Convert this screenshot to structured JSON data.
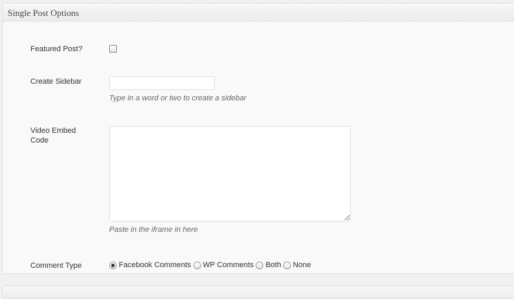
{
  "metabox": {
    "title": "Single Post Options"
  },
  "featured": {
    "label": "Featured Post?",
    "checked": false
  },
  "sidebar": {
    "label": "Create Sidebar",
    "value": "",
    "hint": "Type in a word or two to create a sidebar"
  },
  "video": {
    "label_line1": "Video Embed",
    "label_line2": "Code",
    "value": "",
    "hint": "Paste in the iframe in here"
  },
  "comments": {
    "label": "Comment Type",
    "options": [
      {
        "label": "Facebook Comments",
        "checked": true
      },
      {
        "label": "WP Comments",
        "checked": false
      },
      {
        "label": "Both",
        "checked": false
      },
      {
        "label": "None",
        "checked": false
      }
    ]
  }
}
